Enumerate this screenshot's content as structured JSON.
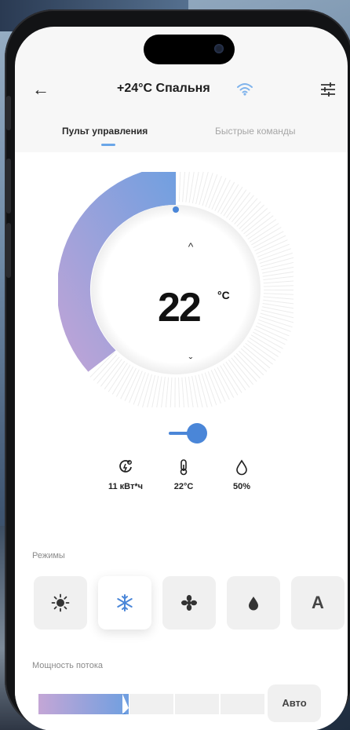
{
  "header": {
    "back_glyph": "←",
    "title": "+24°C Спальня",
    "wifi_icon": "wifi-icon",
    "settings_icon": "sliders-icon"
  },
  "tabs": [
    {
      "label": "Пульт управления",
      "active": true
    },
    {
      "label": "Быстрые команды",
      "active": false
    }
  ],
  "thermostat": {
    "temperature": "22",
    "unit": "°C",
    "up_glyph": "^",
    "down_glyph": "ˇ",
    "colors": {
      "gradient_start": "#c3a4d6",
      "gradient_end": "#6f9fe0",
      "knob": "#4a86d8"
    }
  },
  "stats": [
    {
      "icon": "energy-icon",
      "value": "11 кВт*ч"
    },
    {
      "icon": "thermometer-icon",
      "value": "22°C"
    },
    {
      "icon": "humidity-drop-icon",
      "value": "50%"
    }
  ],
  "modes": {
    "label": "Режимы",
    "items": [
      {
        "icon": "sun-icon",
        "name": "heat",
        "active": false
      },
      {
        "icon": "snowflake-icon",
        "name": "cool",
        "active": true
      },
      {
        "icon": "fan-icon",
        "name": "fan",
        "active": false
      },
      {
        "icon": "drop-icon",
        "name": "dry",
        "active": false
      },
      {
        "icon": "auto-icon",
        "name": "auto",
        "label": "A",
        "active": false
      }
    ]
  },
  "flow": {
    "label": "Мощность потока",
    "level": 0.4,
    "auto_label": "Авто"
  }
}
